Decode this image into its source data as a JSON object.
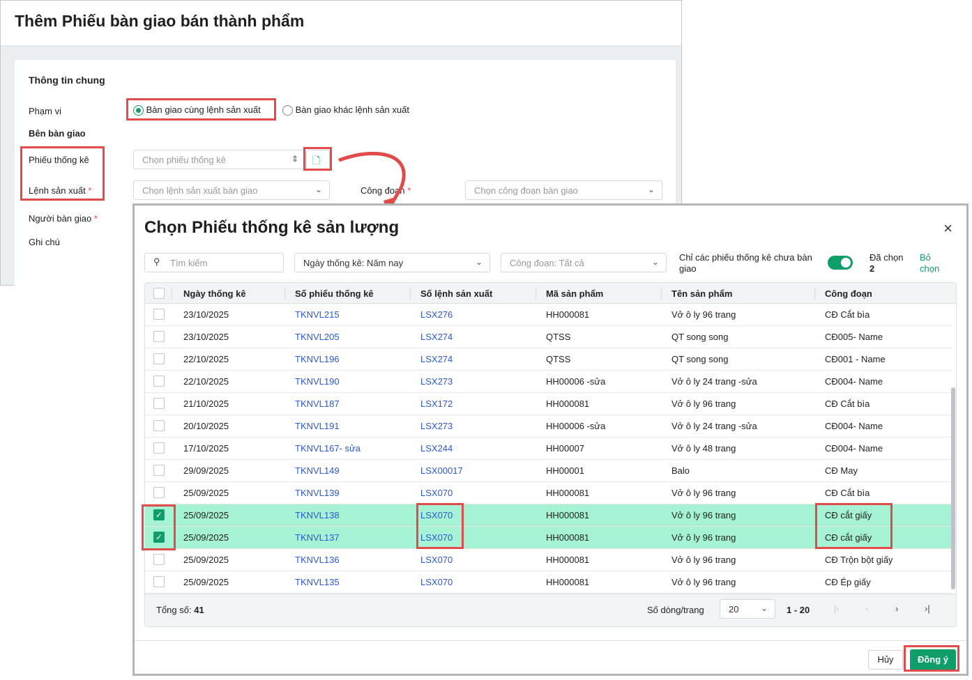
{
  "page": {
    "title": "Thêm Phiếu bàn giao bán thành phẩm",
    "section": "Thông tin chung",
    "pham_vi_label": "Phạm vi",
    "radio_same": "Bàn giao cùng lệnh sản xuất",
    "radio_other": "Bàn giao khác lệnh sản xuất",
    "ben_ban_giao": "Bên bàn giao",
    "phieu_label": "Phiếu thống kê",
    "phieu_placeholder": "Chọn phiếu thống kê",
    "lenh_label": "Lệnh sản xuất",
    "lenh_placeholder": "Chọn lệnh sản xuất bàn giao",
    "cong_doan_label": "Công đoạn",
    "cong_doan_placeholder": "Chọn công đoạn bàn giao",
    "nguoi_label": "Người bàn giao",
    "ghi_chu_label": "Ghi chú",
    "req": "*"
  },
  "modal": {
    "title": "Chọn Phiếu thống kê sản lượng",
    "search_placeholder": "Tìm kiếm",
    "date_filter": "Ngày thống kê: Năm nay",
    "stage_filter": "Công đoạn: Tất cả",
    "toggle_label": "Chỉ các phiếu thống kê chưa bàn giao",
    "toggle_on": true,
    "selected_label": "Đã chọn",
    "selected_count": "2",
    "deselect": "Bỏ chọn",
    "columns": [
      "Ngày thống kê",
      "Số phiếu thống kê",
      "Số lệnh sản xuất",
      "Mã sản phẩm",
      "Tên sản phẩm",
      "Công đoạn"
    ],
    "rows": [
      [
        "23/10/2025",
        "TKNVL215",
        "LSX276",
        "HH000081",
        "Vở ô ly 96 trang",
        "CĐ Cắt bìa",
        false
      ],
      [
        "23/10/2025",
        "TKNVL205",
        "LSX274",
        "QTSS",
        "QT song song",
        "CĐ005- Name",
        false
      ],
      [
        "22/10/2025",
        "TKNVL196",
        "LSX274",
        "QTSS",
        "QT song song",
        "CĐ001 - Name",
        false
      ],
      [
        "22/10/2025",
        "TKNVL190",
        "LSX273",
        "HH00006 -sửa",
        "Vở ô ly 24 trang -sửa",
        "CĐ004- Name",
        false
      ],
      [
        "21/10/2025",
        "TKNVL187",
        "LSX172",
        "HH000081",
        "Vở ô ly 96 trang",
        "CĐ Cắt bìa",
        false
      ],
      [
        "20/10/2025",
        "TKNVL191",
        "LSX273",
        "HH00006 -sửa",
        "Vở ô ly 24 trang -sửa",
        "CĐ004- Name",
        false
      ],
      [
        "17/10/2025",
        "TKNVL167- sửa",
        "LSX244",
        "HH00007",
        "Vở ô ly 48 trang",
        "CĐ004- Name",
        false
      ],
      [
        "29/09/2025",
        "TKNVL149",
        "LSX00017",
        "HH00001",
        "Balo",
        "CĐ May",
        false
      ],
      [
        "25/09/2025",
        "TKNVL139",
        "LSX070",
        "HH000081",
        "Vở ô ly 96 trang",
        "CĐ Cắt bìa",
        false
      ],
      [
        "25/09/2025",
        "TKNVL138",
        "LSX070",
        "HH000081",
        "Vở ô ly 96 trang",
        "CĐ cắt giấy",
        true
      ],
      [
        "25/09/2025",
        "TKNVL137",
        "LSX070",
        "HH000081",
        "Vở ô ly 96 trang",
        "CĐ cắt giấy",
        true
      ],
      [
        "25/09/2025",
        "TKNVL136",
        "LSX070",
        "HH000081",
        "Vở ô ly 96 trang",
        "CĐ Trộn bột giấy",
        false
      ],
      [
        "25/09/2025",
        "TKNVL135",
        "LSX070",
        "HH000081",
        "Vở ô ly 96 trang",
        "CĐ Ép giấy",
        false
      ]
    ],
    "total_label": "Tổng số:",
    "total": "41",
    "per_page_label": "Số dòng/trang",
    "per_page": "20",
    "range": "1 - 20",
    "cancel": "Hủy",
    "ok": "Đồng ý"
  },
  "colors": {
    "accent": "#0f9d6a",
    "selected_row": "#a5f2d5",
    "annotation": "#e24b4b",
    "link": "#2d58d6"
  }
}
